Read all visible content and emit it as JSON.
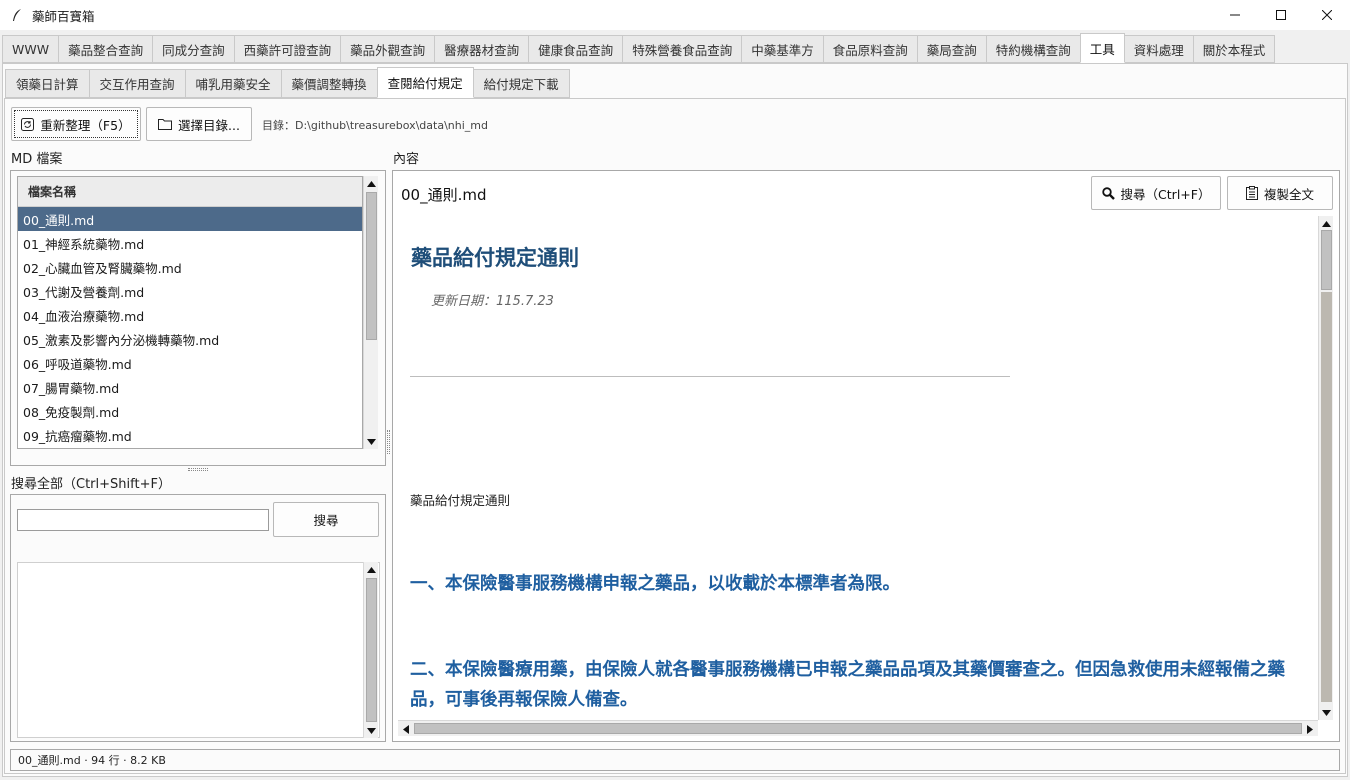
{
  "window": {
    "title": "藥師百寶箱",
    "icon": "feather-icon",
    "controls": [
      "minimize-icon",
      "maximize-icon",
      "close-icon"
    ]
  },
  "main_tabs": [
    {
      "label": "WWW"
    },
    {
      "label": "藥品整合查詢"
    },
    {
      "label": "同成分查詢"
    },
    {
      "label": "西藥許可證查詢"
    },
    {
      "label": "藥品外觀查詢"
    },
    {
      "label": "醫療器材查詢"
    },
    {
      "label": "健康食品查詢"
    },
    {
      "label": "特殊營養食品查詢"
    },
    {
      "label": "中藥基準方"
    },
    {
      "label": "食品原料查詢"
    },
    {
      "label": "藥局查詢"
    },
    {
      "label": "特約機構查詢"
    },
    {
      "label": "工具",
      "active": true
    },
    {
      "label": "資料處理"
    },
    {
      "label": "關於本程式"
    }
  ],
  "sub_tabs": [
    {
      "label": "領藥日計算"
    },
    {
      "label": "交互作用查詢"
    },
    {
      "label": "哺乳用藥安全"
    },
    {
      "label": "藥價調整轉換"
    },
    {
      "label": "查閱給付規定",
      "active": true
    },
    {
      "label": "給付規定下載"
    }
  ],
  "toolbar": {
    "refresh_label": "重新整理（F5）",
    "refresh_icon": "refresh-icon",
    "choose_dir_label": "選擇目錄...",
    "choose_dir_icon": "folder-icon",
    "dir_text": "目錄：D:\\github\\treasurebox\\data\\nhi_md"
  },
  "left": {
    "files_section": "MD 檔案",
    "column_header": "檔案名稱",
    "files": [
      "00_通則.md",
      "01_神經系統藥物.md",
      "02_心臟血管及腎臟藥物.md",
      "03_代謝及營養劑.md",
      "04_血液治療藥物.md",
      "05_激素及影響內分泌機轉藥物.md",
      "06_呼吸道藥物.md",
      "07_腸胃藥物.md",
      "08_免疫製劑.md",
      "09_抗癌瘤藥物.md"
    ],
    "selected_index": 0,
    "search_section": "搜尋全部（Ctrl+Shift+F）",
    "search_value": "",
    "search_button": "搜尋"
  },
  "right": {
    "section": "內容",
    "filename": "00_通則.md",
    "find_label": "搜尋（Ctrl+F）",
    "find_icon": "magnifier-icon",
    "copy_label": "複製全文",
    "copy_icon": "clipboard-icon",
    "doc": {
      "heading": "藥品給付規定通則",
      "updated": "更新日期：115.7.23",
      "para": "藥品給付規定通則",
      "item1": "一、本保險醫事服務機構申報之藥品，以收載於本標準者為限。",
      "item2": "二、本保險醫療用藥，由保險人就各醫事服務機構已申報之藥品品項及其藥價審查之。但因急救使用未經報備之藥品，可事後再報保險人備查。"
    }
  },
  "status": "00_通則.md · 94 行 · 8.2 KB",
  "colors": {
    "selection": "#4d6a8a",
    "heading": "#1f4e79",
    "item": "#1f5fa0"
  }
}
